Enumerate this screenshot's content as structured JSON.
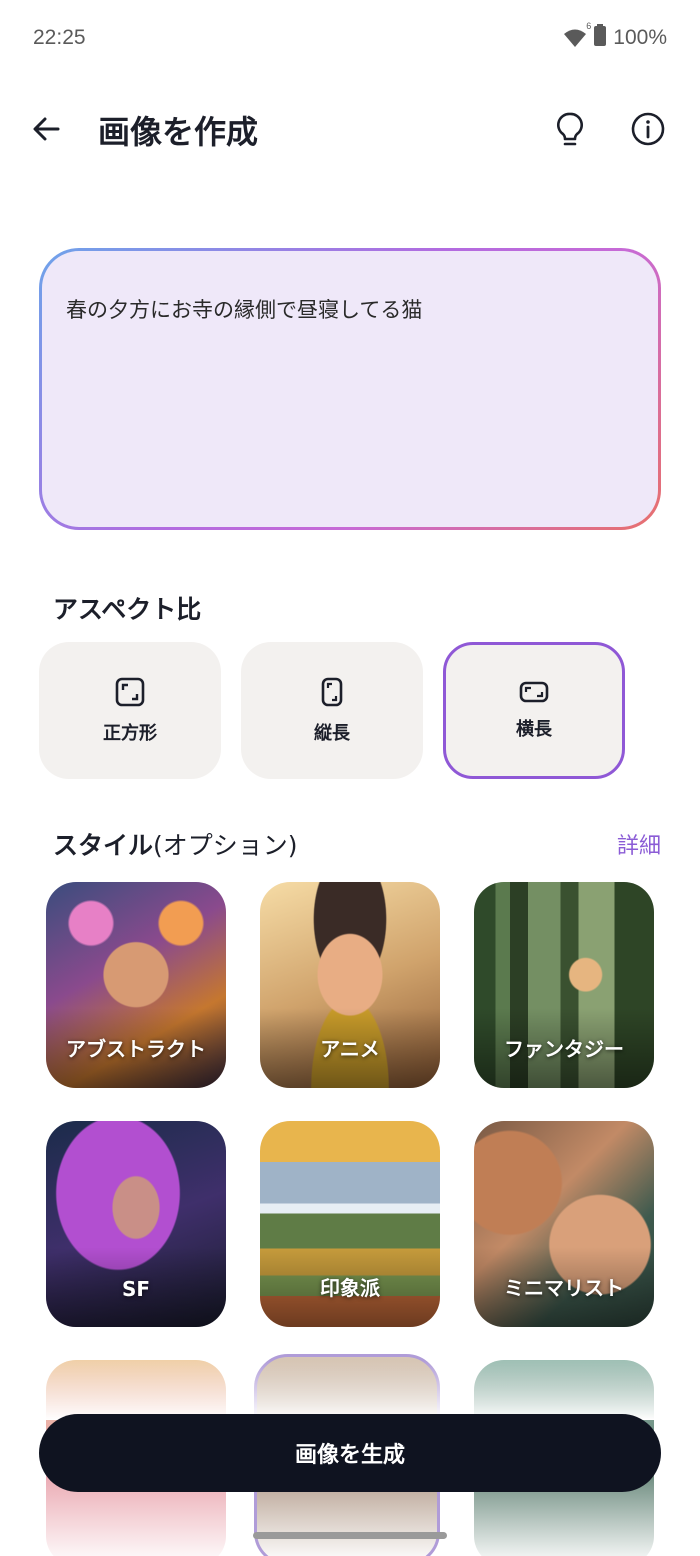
{
  "status": {
    "time": "22:25",
    "battery": "100%",
    "wifi_badge": "6"
  },
  "header": {
    "title": "画像を作成",
    "icons": [
      "arrow-left-icon",
      "lightbulb-icon",
      "info-icon"
    ]
  },
  "prompt": {
    "value": "春の夕方にお寺の縁側で昼寝してる猫"
  },
  "aspect": {
    "title": "アスペクト比",
    "options": [
      {
        "label": "正方形",
        "icon": "square-icon",
        "selected": false
      },
      {
        "label": "縦長",
        "icon": "portrait-icon",
        "selected": false
      },
      {
        "label": "横長",
        "icon": "landscape-icon",
        "selected": true
      }
    ]
  },
  "style": {
    "title": "スタイル",
    "subtitle": "(オプション)",
    "detail_link": "詳細",
    "items": [
      {
        "label": "アブストラクト"
      },
      {
        "label": "アニメ"
      },
      {
        "label": "ファンタジー"
      },
      {
        "label": "SF"
      },
      {
        "label": "印象派"
      },
      {
        "label": "ミニマリスト"
      }
    ]
  },
  "actions": {
    "generate_label": "画像を生成"
  },
  "colors": {
    "accent": "#8b5cd6",
    "button_bg": "#0f1320",
    "prompt_bg": "#efe8f9"
  }
}
